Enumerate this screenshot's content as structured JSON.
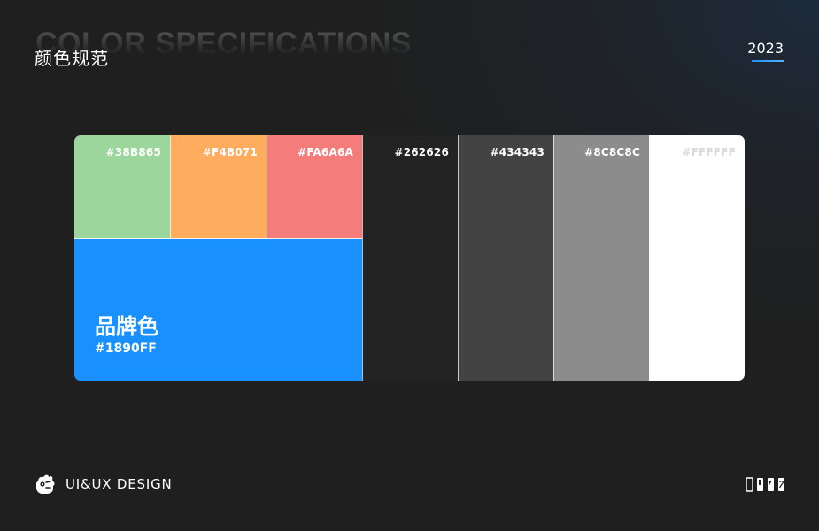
{
  "header": {
    "bg_title": "COLOR SPECIFICATIONS",
    "title": "颜色规范",
    "year": "2023"
  },
  "palette": {
    "swatches": [
      {
        "label": "#38B865",
        "color": "#9dd69c"
      },
      {
        "label": "#F4B071",
        "color": "#ffac5e"
      },
      {
        "label": "#FA6A6A",
        "color": "#f47d7c"
      },
      {
        "label": "#262626",
        "color": "#232323"
      },
      {
        "label": "#434343",
        "color": "#434343"
      },
      {
        "label": "#8C8C8C",
        "color": "#8c8c8c"
      },
      {
        "label": "#FFFFFF",
        "color": "#ffffff",
        "text_color": "#d9d9d9"
      }
    ],
    "brand": {
      "title": "品牌色",
      "label": "#1890FF",
      "color": "#1890ff"
    }
  },
  "footer": {
    "text": "UI&UX DESIGN"
  },
  "colors": {
    "accent": "#1890ff",
    "background": "#1f1f1f"
  }
}
